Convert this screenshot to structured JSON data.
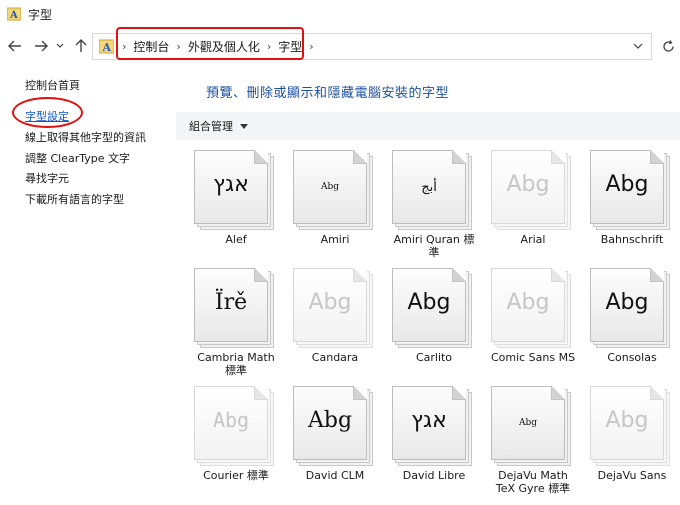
{
  "window": {
    "title": "字型"
  },
  "breadcrumb": [
    "控制台",
    "外觀及個人化",
    "字型"
  ],
  "sidebar": {
    "items": [
      {
        "label": "控制台首頁"
      },
      {
        "label": "字型設定"
      },
      {
        "label": "線上取得其他字型的資訊"
      },
      {
        "label": "調整 ClearType 文字"
      },
      {
        "label": "尋找字元"
      },
      {
        "label": "下載所有語言的字型"
      }
    ]
  },
  "main": {
    "heading": "預覽、刪除或顯示和隱藏電腦安裝的字型",
    "toolbar": {
      "organize": "組合管理"
    }
  },
  "fonts": [
    {
      "name": "Alef",
      "sample": "אגץ",
      "style": "large",
      "faded": false
    },
    {
      "name": "Amiri",
      "sample": "Abg",
      "style": "small",
      "faded": false
    },
    {
      "name": "Amiri Quran 標\n準",
      "sample": "أبج",
      "style": "arabic",
      "faded": false
    },
    {
      "name": "Arial",
      "sample": "Abg",
      "style": "large",
      "faded": true
    },
    {
      "name": "Bahnschrift",
      "sample": "Abg",
      "style": "large",
      "faded": false
    },
    {
      "name": "Cambria Math\n標準",
      "sample": "Ïrě",
      "style": "serif",
      "faded": false
    },
    {
      "name": "Candara",
      "sample": "Abg",
      "style": "large",
      "faded": true
    },
    {
      "name": "Carlito",
      "sample": "Abg",
      "style": "large",
      "faded": false
    },
    {
      "name": "Comic Sans MS",
      "sample": "Abg",
      "style": "large",
      "faded": true
    },
    {
      "name": "Consolas",
      "sample": "Abg",
      "style": "large",
      "faded": false
    },
    {
      "name": "Courier 標準",
      "sample": "Abg",
      "style": "mono",
      "faded": true
    },
    {
      "name": "David CLM",
      "sample": "Abg",
      "style": "serif",
      "faded": false
    },
    {
      "name": "David Libre",
      "sample": "אגץ",
      "style": "large",
      "faded": false
    },
    {
      "name": "DejaVu Math\nTeX Gyre 標準",
      "sample": "Abg",
      "style": "small",
      "faded": false
    },
    {
      "name": "DejaVu Sans",
      "sample": "Abg",
      "style": "large",
      "faded": true
    }
  ]
}
